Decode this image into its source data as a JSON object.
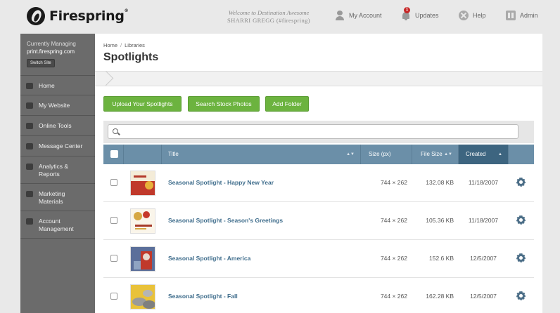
{
  "brand": {
    "name": "Firespring",
    "trademark": "®"
  },
  "welcome": {
    "line1": "Welcome to Destination Awesome",
    "line2": "SHARRI GREGG (#firespring)"
  },
  "topnav": {
    "account": "My Account",
    "updates": "Updates",
    "updates_count": "1",
    "help": "Help",
    "admin": "Admin"
  },
  "sidebar": {
    "managing_label": "Currently Managing",
    "site": "print.firespring.com",
    "switch": "Switch Site",
    "items": [
      {
        "label": "Home",
        "icon": "home-icon"
      },
      {
        "label": "My Website",
        "icon": "flag-icon"
      },
      {
        "label": "Online Tools",
        "icon": "toolbox-icon"
      },
      {
        "label": "Message Center",
        "icon": "chat-icon"
      },
      {
        "label": "Analytics & Reports",
        "icon": "chart-icon"
      },
      {
        "label": "Marketing Materials",
        "icon": "tag-icon"
      },
      {
        "label": "Account Management",
        "icon": "account-icon"
      }
    ]
  },
  "breadcrumb": {
    "home": "Home",
    "separator": "/",
    "libraries": "Libraries"
  },
  "page_title": "Spotlights",
  "path": {
    "root": "/"
  },
  "buttons": {
    "upload": "Upload Your Spotlights",
    "stock": "Search Stock Photos",
    "folder": "Add Folder"
  },
  "search": {
    "placeholder": ""
  },
  "table": {
    "columns": {
      "title": "Title",
      "size": "Size (px)",
      "file_size": "File Size",
      "created": "Created"
    },
    "sort_both": "▲▼",
    "sort_asc": "▲",
    "rows": [
      {
        "title": "Seasonal Spotlight - Happy New Year",
        "size": "744 × 262",
        "file_size": "132.08 KB",
        "created": "11/18/2007"
      },
      {
        "title": "Seasonal Spotlight - Season's Greetings",
        "size": "744 × 262",
        "file_size": "105.36 KB",
        "created": "11/18/2007"
      },
      {
        "title": "Seasonal Spotlight - America",
        "size": "744 × 262",
        "file_size": "152.6 KB",
        "created": "12/5/2007"
      },
      {
        "title": "Seasonal Spotlight - Fall",
        "size": "744 × 262",
        "file_size": "162.28 KB",
        "created": "12/5/2007"
      }
    ]
  },
  "colors": {
    "green": "#6cb33f",
    "header": "#6b8fa8",
    "sorted_header": "#3d6580",
    "link": "#3f6d8c",
    "sidebar": "#6b6b6b"
  }
}
